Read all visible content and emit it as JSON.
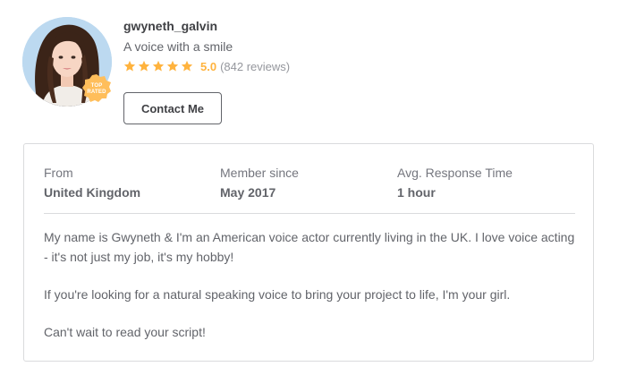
{
  "seller": {
    "username": "gwyneth_galvin",
    "tagline": "A voice with a smile",
    "badge_text": "TOP RATED",
    "rating": {
      "score": "5.0",
      "reviews": "(842 reviews)",
      "stars": 5,
      "star_color": "#ffb33e"
    },
    "contact_label": "Contact Me"
  },
  "stats": [
    {
      "label": "From",
      "value": "United Kingdom"
    },
    {
      "label": "Member since",
      "value": "May 2017"
    },
    {
      "label": "Avg. Response Time",
      "value": "1 hour"
    }
  ],
  "bio": [
    "My name is Gwyneth & I'm an American voice actor currently living in the UK. I love voice acting - it's not just my job, it's my hobby!",
    "If you're looking for a natural speaking voice to bring your project to life, I'm your girl.",
    "Can't wait to read your script!"
  ],
  "colors": {
    "badge": "#ffbe5b",
    "text_primary": "#404145",
    "text_secondary": "#62646a",
    "border": "#dadbdd"
  }
}
